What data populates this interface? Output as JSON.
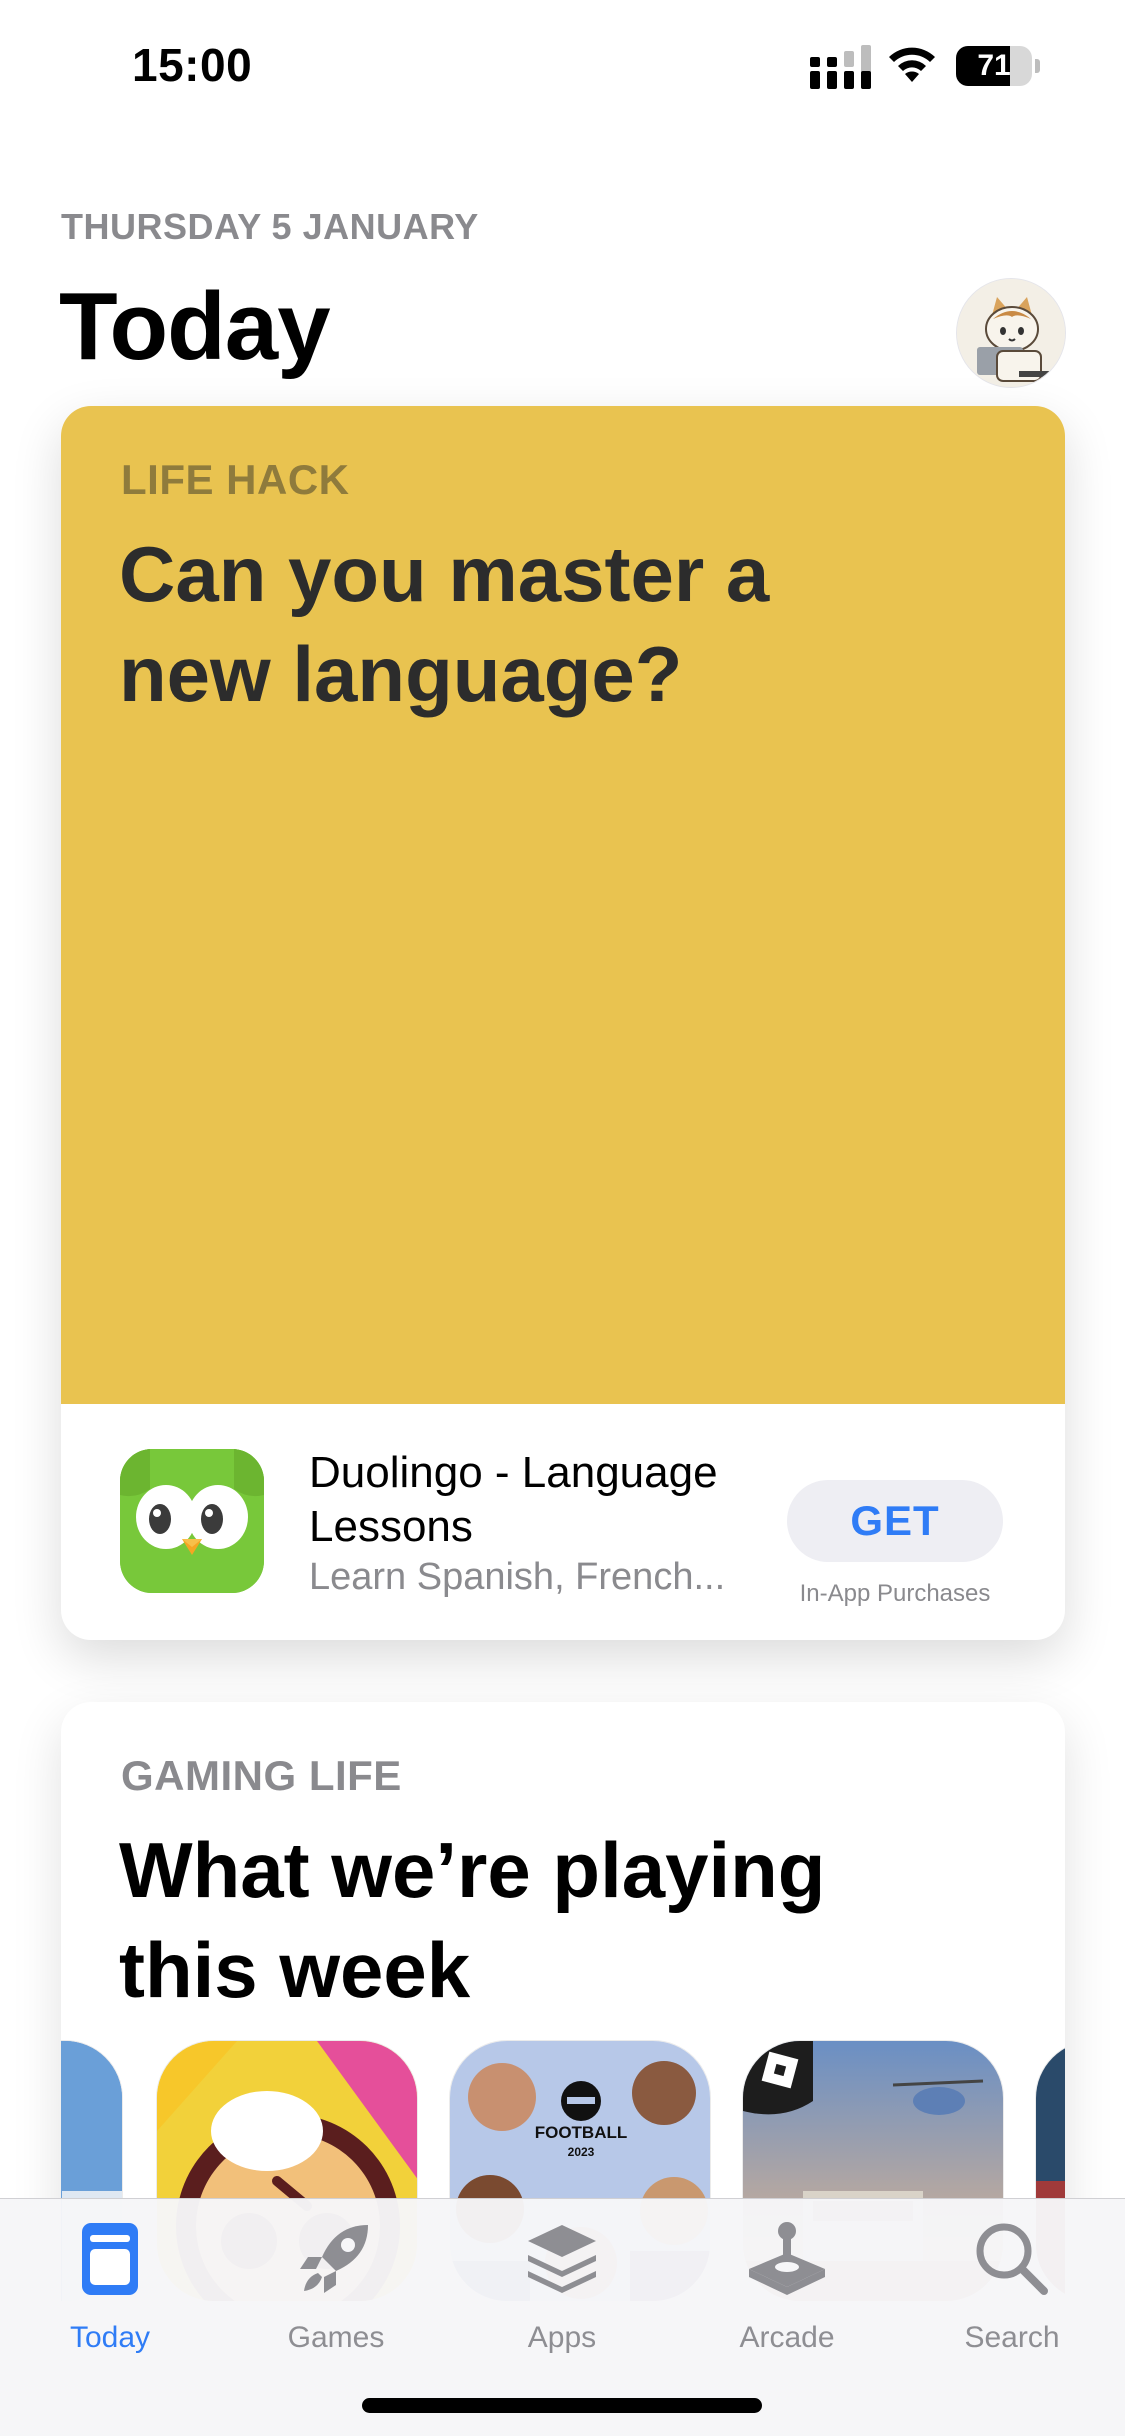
{
  "status_bar": {
    "time": "15:00",
    "battery_percent": "71",
    "battery_level": 0.71,
    "signal_icon": "cellular-signal-icon",
    "wifi_icon": "wifi-icon"
  },
  "header": {
    "date": "THURSDAY 5 JANUARY",
    "title": "Today",
    "avatar_icon": "account-avatar-cat"
  },
  "featured_card": {
    "eyebrow": "LIFE HACK",
    "title": "Can you master a new language?",
    "background_color": "#e9c350",
    "app": {
      "icon": "duolingo-owl-icon",
      "name": "Duolingo - Language Lessons",
      "subtitle": "Learn Spanish, French...",
      "button_label": "GET",
      "purchase_note": "In-App Purchases"
    }
  },
  "second_card": {
    "eyebrow": "GAMING LIFE",
    "title": "What we’re playing this week",
    "games": [
      {
        "icon": "partial-game-icon-left"
      },
      {
        "icon": "brawl-stars-icon"
      },
      {
        "icon": "efootball-2023-icon",
        "text_line1": "FOOTBALL",
        "text_line2": "2023"
      },
      {
        "icon": "roblox-icon"
      },
      {
        "icon": "partial-game-icon-right"
      }
    ]
  },
  "tab_bar": {
    "tabs": [
      {
        "label": "Today",
        "icon": "today-icon",
        "active": true
      },
      {
        "label": "Games",
        "icon": "rocket-icon",
        "active": false
      },
      {
        "label": "Apps",
        "icon": "stack-icon",
        "active": false
      },
      {
        "label": "Arcade",
        "icon": "joystick-icon",
        "active": false
      },
      {
        "label": "Search",
        "icon": "search-icon",
        "active": false
      }
    ]
  },
  "colors": {
    "accent": "#2f7cf6",
    "secondary_text": "#8a8a8e",
    "card_yellow": "#e9c350"
  }
}
